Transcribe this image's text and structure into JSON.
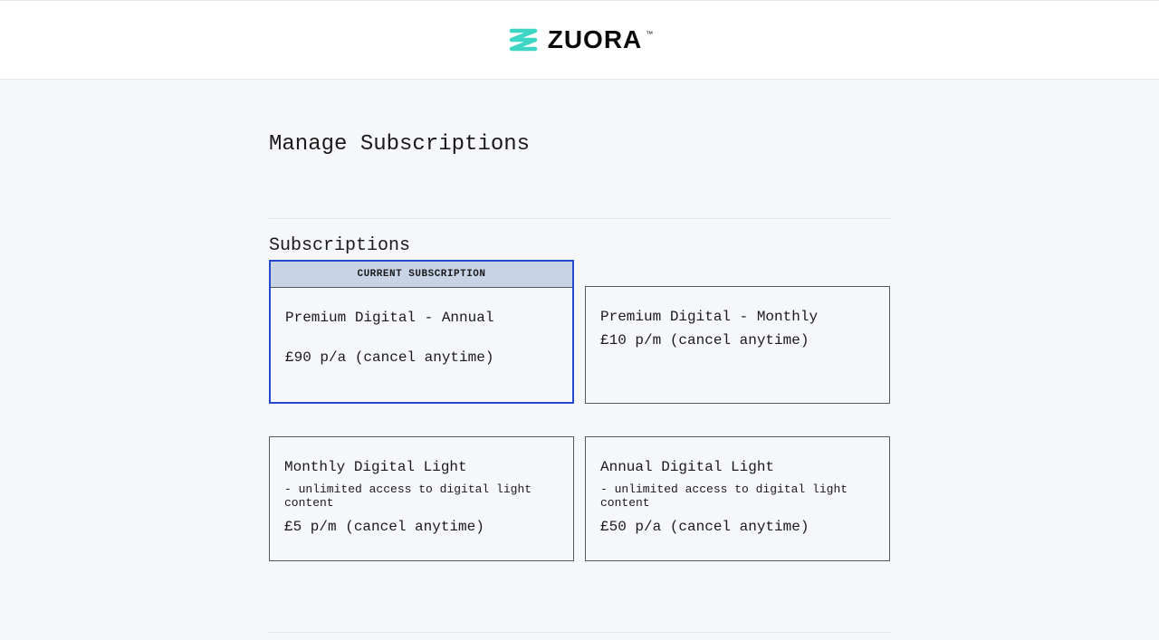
{
  "header": {
    "logo_text": "ZUORA",
    "logo_tm": "™"
  },
  "page": {
    "title": "Manage Subscriptions",
    "section_title": "Subscriptions",
    "current_label": "CURRENT SUBSCRIPTION"
  },
  "cards": [
    {
      "name": "Premium Digital - Annual",
      "description": "",
      "price": "£90 p/a (cancel anytime)",
      "current": true
    },
    {
      "name": "Premium Digital - Monthly",
      "description": "",
      "price": "£10 p/m (cancel anytime)",
      "current": false
    },
    {
      "name": "Monthly Digital Light",
      "description": "- unlimited access to digital light content",
      "price": "£5 p/m (cancel anytime)",
      "current": false
    },
    {
      "name": "Annual Digital Light",
      "description": "- unlimited access to digital light content",
      "price": "£50 p/a (cancel anytime)",
      "current": false
    }
  ]
}
